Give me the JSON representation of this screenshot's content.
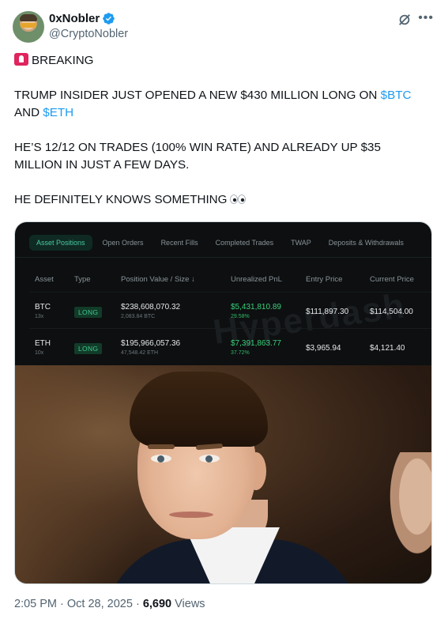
{
  "author": {
    "display_name": "0xNobler",
    "handle": "@CryptoNobler"
  },
  "icons": {
    "verified": "verified-badge-icon",
    "grok": "grok-icon",
    "more": "more-icon",
    "siren": "siren-icon",
    "eyes": "eyes-icon"
  },
  "tweet": {
    "line1": "BREAKING",
    "line2a": "TRUMP INSIDER JUST OPENED A NEW $430 MILLION LONG ON ",
    "line2_cashtag": "$BTC",
    "line3a": "AND ",
    "line3_cashtag": "$ETH",
    "line4": "HE’S 12/12 ON TRADES (100% WIN RATE) AND ALREADY UP $35",
    "line5": "MILLION IN JUST A FEW DAYS.",
    "line6": "HE DEFINITELY KNOWS SOMETHING"
  },
  "panel": {
    "tabs": [
      "Asset Positions",
      "Open Orders",
      "Recent Fills",
      "Completed Trades",
      "TWAP",
      "Deposits & Withdrawals"
    ],
    "headers": {
      "asset": "Asset",
      "type": "Type",
      "value": "Position Value / Size ↓",
      "pnl": "Unrealized PnL",
      "entry": "Entry Price",
      "current": "Current Price"
    },
    "rows": [
      {
        "asset": "BTC",
        "leverage": "13x",
        "type": "LONG",
        "value": "$238,608,070.32",
        "size": "2,083.84 BTC",
        "pnl": "$5,431,810.89",
        "pnl_pct": "29.58%",
        "entry": "$111,897.30",
        "current": "$114,504.00"
      },
      {
        "asset": "ETH",
        "leverage": "10x",
        "type": "LONG",
        "value": "$195,966,057.36",
        "size": "47,548.42 ETH",
        "pnl": "$7,391,863.77",
        "pnl_pct": "37.72%",
        "entry": "$3,965.94",
        "current": "$4,121.40"
      }
    ],
    "watermark": "Hyperdash"
  },
  "footer": {
    "timestamp": "2:05 PM · Oct 28, 2025 · ",
    "views_count": "6,690",
    "views_label": " Views"
  }
}
